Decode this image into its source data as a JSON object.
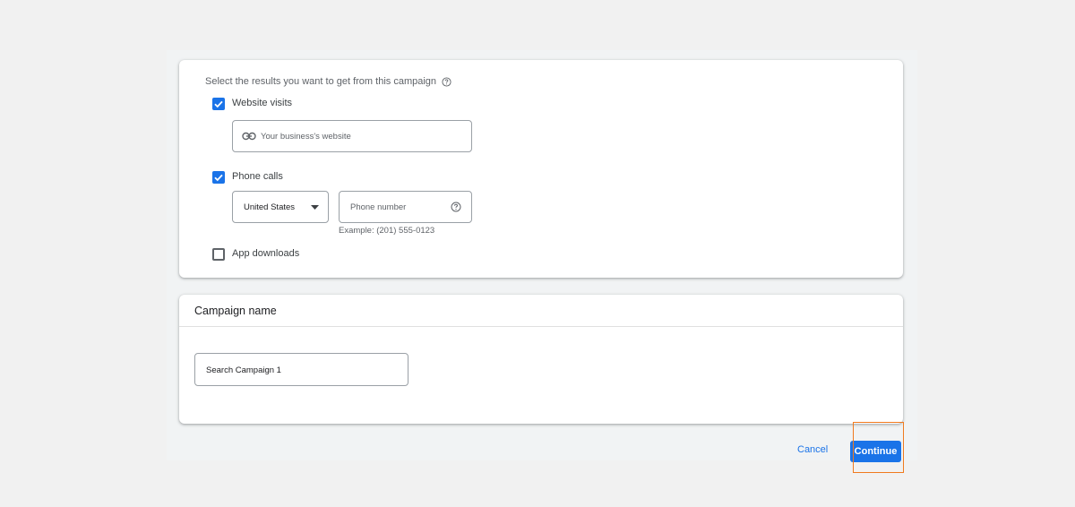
{
  "goals": {
    "prompt": "Select the results you want to get from this campaign",
    "website_visits": {
      "label": "Website visits",
      "checked": true,
      "placeholder": "Your business's website"
    },
    "phone_calls": {
      "label": "Phone calls",
      "checked": true,
      "country": "United States",
      "phone_placeholder": "Phone number",
      "example": "Example: (201) 555-0123"
    },
    "app_downloads": {
      "label": "App downloads",
      "checked": false
    }
  },
  "campaign_name": {
    "title": "Campaign name",
    "value": "Search Campaign 1"
  },
  "actions": {
    "cancel_label": "Cancel",
    "continue_label": "Continue"
  },
  "colors": {
    "accent": "#1a73e8",
    "highlight": "#f07a1e"
  }
}
